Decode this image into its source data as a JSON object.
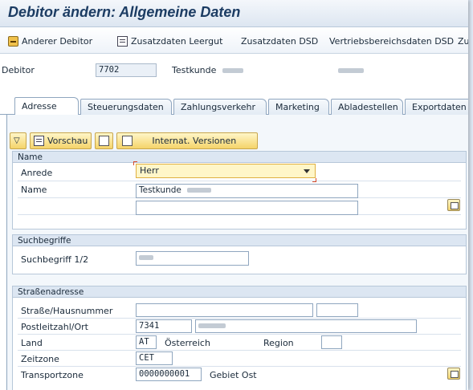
{
  "window": {
    "title": "Debitor ändern: Allgemeine Daten"
  },
  "toolbar": {
    "other_customer": "Anderer Debitor",
    "extra_empties": "Zusatzdaten Leergut",
    "extra_dsd": "Zusatzdaten DSD",
    "sales_area_dsd": "Vertriebsbereichsdaten DSD",
    "overflow": "Zu"
  },
  "header": {
    "customer_label": "Debitor",
    "customer_value": "7702",
    "customer_name": "Testkunde"
  },
  "tabs": [
    {
      "label": "Adresse",
      "active": true
    },
    {
      "label": "Steuerungsdaten"
    },
    {
      "label": "Zahlungsverkehr"
    },
    {
      "label": "Marketing"
    },
    {
      "label": "Abladestellen"
    },
    {
      "label": "Exportdaten"
    }
  ],
  "panel_toolbar": {
    "preview_label": "Vorschau",
    "intl_versions_label": "Internat. Versionen"
  },
  "name_group": {
    "title": "Name",
    "salutation_label": "Anrede",
    "salutation_value": "Herr",
    "name_label": "Name",
    "name_value": "Testkunde",
    "name2_value": ""
  },
  "search_group": {
    "title": "Suchbegriffe",
    "search_label": "Suchbegriff 1/2"
  },
  "address_group": {
    "title": "Straßenadresse",
    "street_label": "Straße/Hausnummer",
    "street_value": "",
    "house_value": "",
    "postal_label": "Postleitzahl/Ort",
    "postal_value": "7341",
    "country_label": "Land",
    "country_value": "AT",
    "country_name": "Österreich",
    "region_label": "Region",
    "region_value": "",
    "timezone_label": "Zeitzone",
    "timezone_value": "CET",
    "transport_label": "Transportzone",
    "transport_value": "0000000001",
    "transport_desc": "Gebiet Ost"
  },
  "colors": {
    "title": "#1c3c63",
    "required_highlight": "#fff6c8",
    "group_header": "#dce6f2"
  }
}
